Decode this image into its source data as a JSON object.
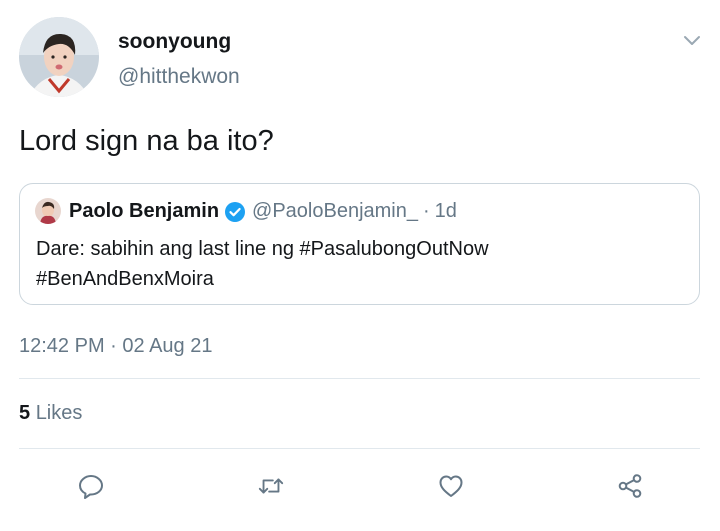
{
  "tweet": {
    "display_name": "soonyoung",
    "handle": "@hitthekwon",
    "text": "Lord sign na ba ito?",
    "timestamp": "12:42 PM · 02 Aug 21",
    "likes_count": "5",
    "likes_label": "Likes"
  },
  "quoted": {
    "display_name": "Paolo Benjamin",
    "handle": "@PaoloBenjamin_",
    "separator": "·",
    "time": "1d",
    "text_line1": "Dare: sabihin ang last line ng #PasalubongOutNow",
    "text_line2": "#BenAndBenxMoira"
  },
  "icons": {
    "menu": "chevron-down-icon",
    "verified": "verified-badge-icon",
    "reply": "reply-icon",
    "retweet": "retweet-icon",
    "like": "heart-icon",
    "share": "share-icon"
  },
  "colors": {
    "text": "#14171a",
    "secondary": "#657786",
    "accent": "#1da1f2",
    "border": "#ccd6dd"
  }
}
